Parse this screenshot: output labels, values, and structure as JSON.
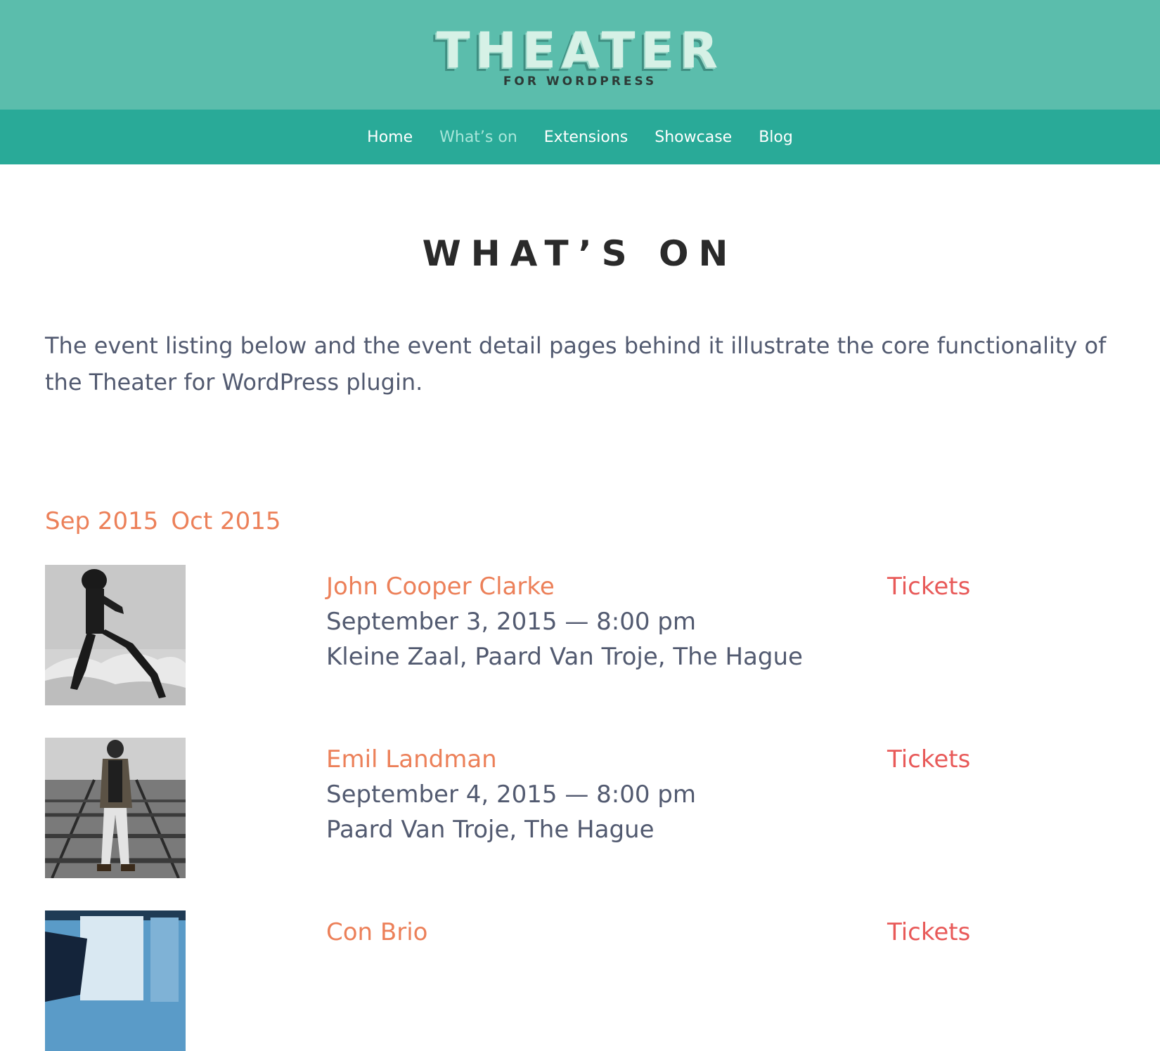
{
  "site": {
    "logo_title": "THEATER",
    "logo_subtitle": "FOR WORDPRESS"
  },
  "nav": {
    "items": [
      {
        "label": "Home",
        "active": false
      },
      {
        "label": "What’s on",
        "active": true
      },
      {
        "label": "Extensions",
        "active": false
      },
      {
        "label": "Showcase",
        "active": false
      },
      {
        "label": "Blog",
        "active": false
      }
    ]
  },
  "page": {
    "title": "WHAT’S ON",
    "intro": "The event listing below and the event detail pages behind it illustrate the core functionality of the Theater for WordPress plugin."
  },
  "months": [
    "Sep 2015",
    "Oct 2015"
  ],
  "events": [
    {
      "title": "John Cooper Clarke",
      "date": "September 3, 2015 — 8:00 pm",
      "venue": "Kleine Zaal, Paard Van Troje, The Hague",
      "tickets_label": "Tickets"
    },
    {
      "title": "Emil Landman",
      "date": "September 4, 2015 — 8:00 pm",
      "venue": "Paard Van Troje, The Hague",
      "tickets_label": "Tickets"
    },
    {
      "title": "Con Brio",
      "date": "",
      "venue": "",
      "tickets_label": "Tickets"
    }
  ],
  "colors": {
    "header_bg": "#5bbdac",
    "nav_bg": "#29aa98",
    "nav_active": "#a8e6da",
    "accent_orange": "#ec8059",
    "tickets_red": "#e85a59",
    "body_text": "#525a70",
    "title_text": "#2a2a2a"
  }
}
